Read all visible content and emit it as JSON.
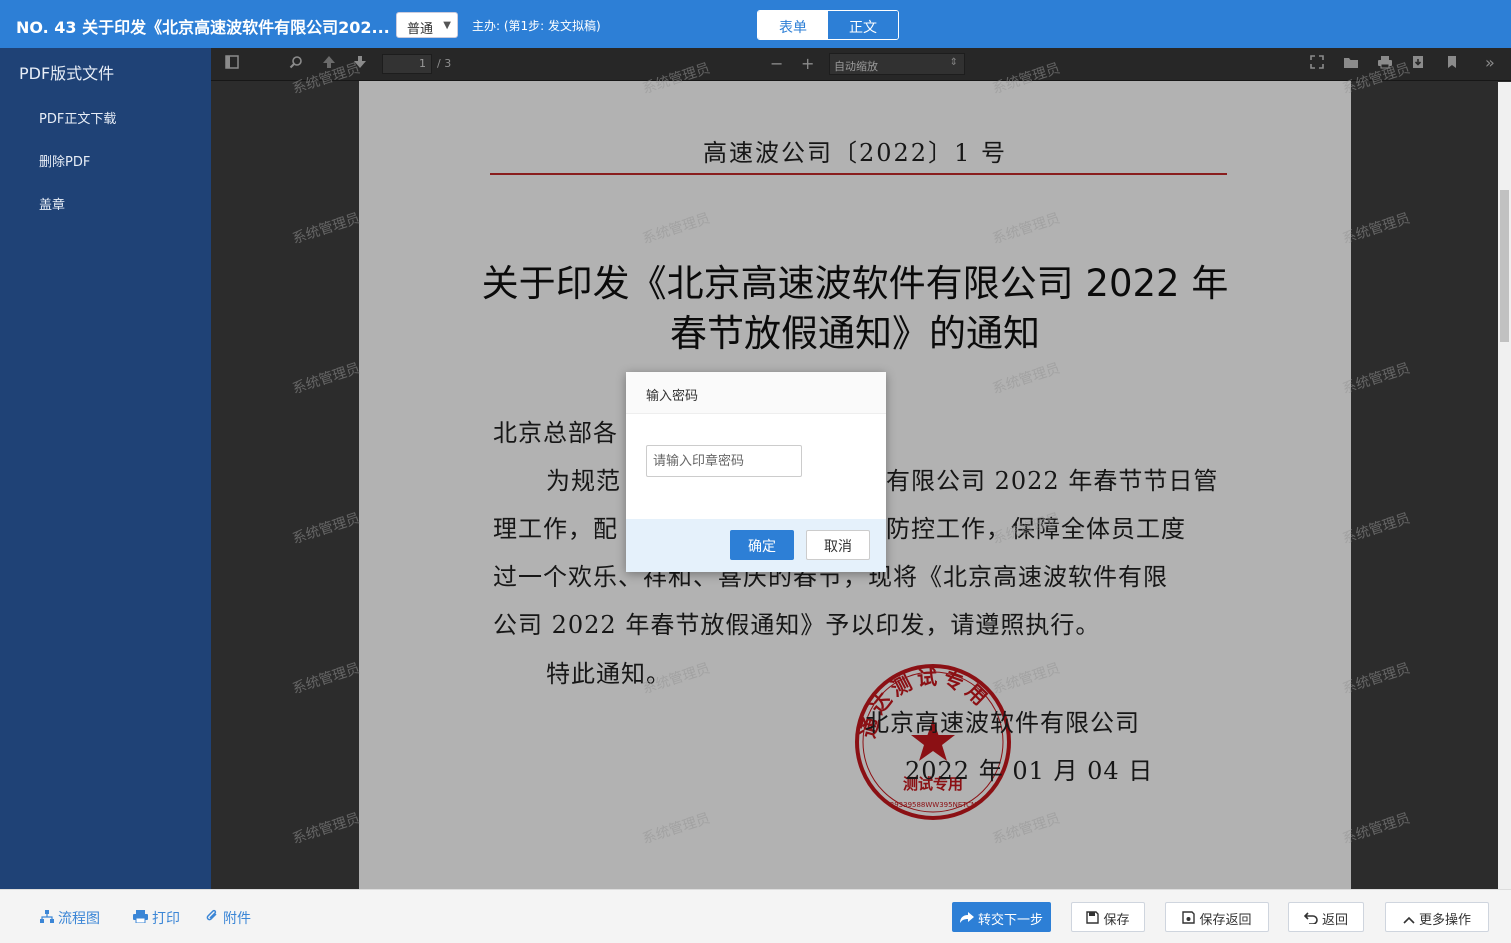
{
  "header": {
    "title": "NO. 43 关于印发《北京高速波软件有限公司202...",
    "urgency": "普通",
    "step": "主办: (第1步: 发文拟稿)",
    "tabs": [
      {
        "label": "表单",
        "active": false
      },
      {
        "label": "正文",
        "active": true
      }
    ],
    "accent_color": "#2d7fd6"
  },
  "sidebar": {
    "title": "PDF版式文件",
    "items": [
      "PDF正文下载",
      "删除PDF",
      "盖章"
    ],
    "color": "#1f4276"
  },
  "viewer": {
    "page_current": "1",
    "page_count": "/ 3",
    "zoom": "自动缩放"
  },
  "document": {
    "doc_no": "高速波公司〔2022〕1 号",
    "heading_lines": [
      "关于印发《北京高速波软件有限公司 2022 年",
      "春节放假通知》的通知"
    ],
    "body_lines": [
      "北京总部各",
      "为规范",
      "有限公司 2022 年春节节日管",
      "理工作，配",
      "防控工作，保障全体员工度",
      "过一个欢乐、祥和、喜庆的春节，现将《北京高速波软件有限",
      "公司 2022 年春节放假通知》予以印发，请遵照执行。",
      "特此通知。"
    ],
    "signature": "北京高速波软件有限公司",
    "date": "2022 年 01 月 04 日",
    "seal": {
      "top_text": "通达测试专用",
      "bottom_text": "测试专用",
      "code": "39339588WW395NETCN",
      "color": "#c8181d"
    },
    "watermark": "系统管理员"
  },
  "dialog": {
    "title": "输入密码",
    "placeholder": "请输入印章密码",
    "ok": "确定",
    "cancel": "取消"
  },
  "footer": {
    "links": [
      "流程图",
      "打印",
      "附件"
    ],
    "buttons": [
      "转交下一步",
      "保存",
      "保存返回",
      "返回",
      "更多操作"
    ]
  }
}
